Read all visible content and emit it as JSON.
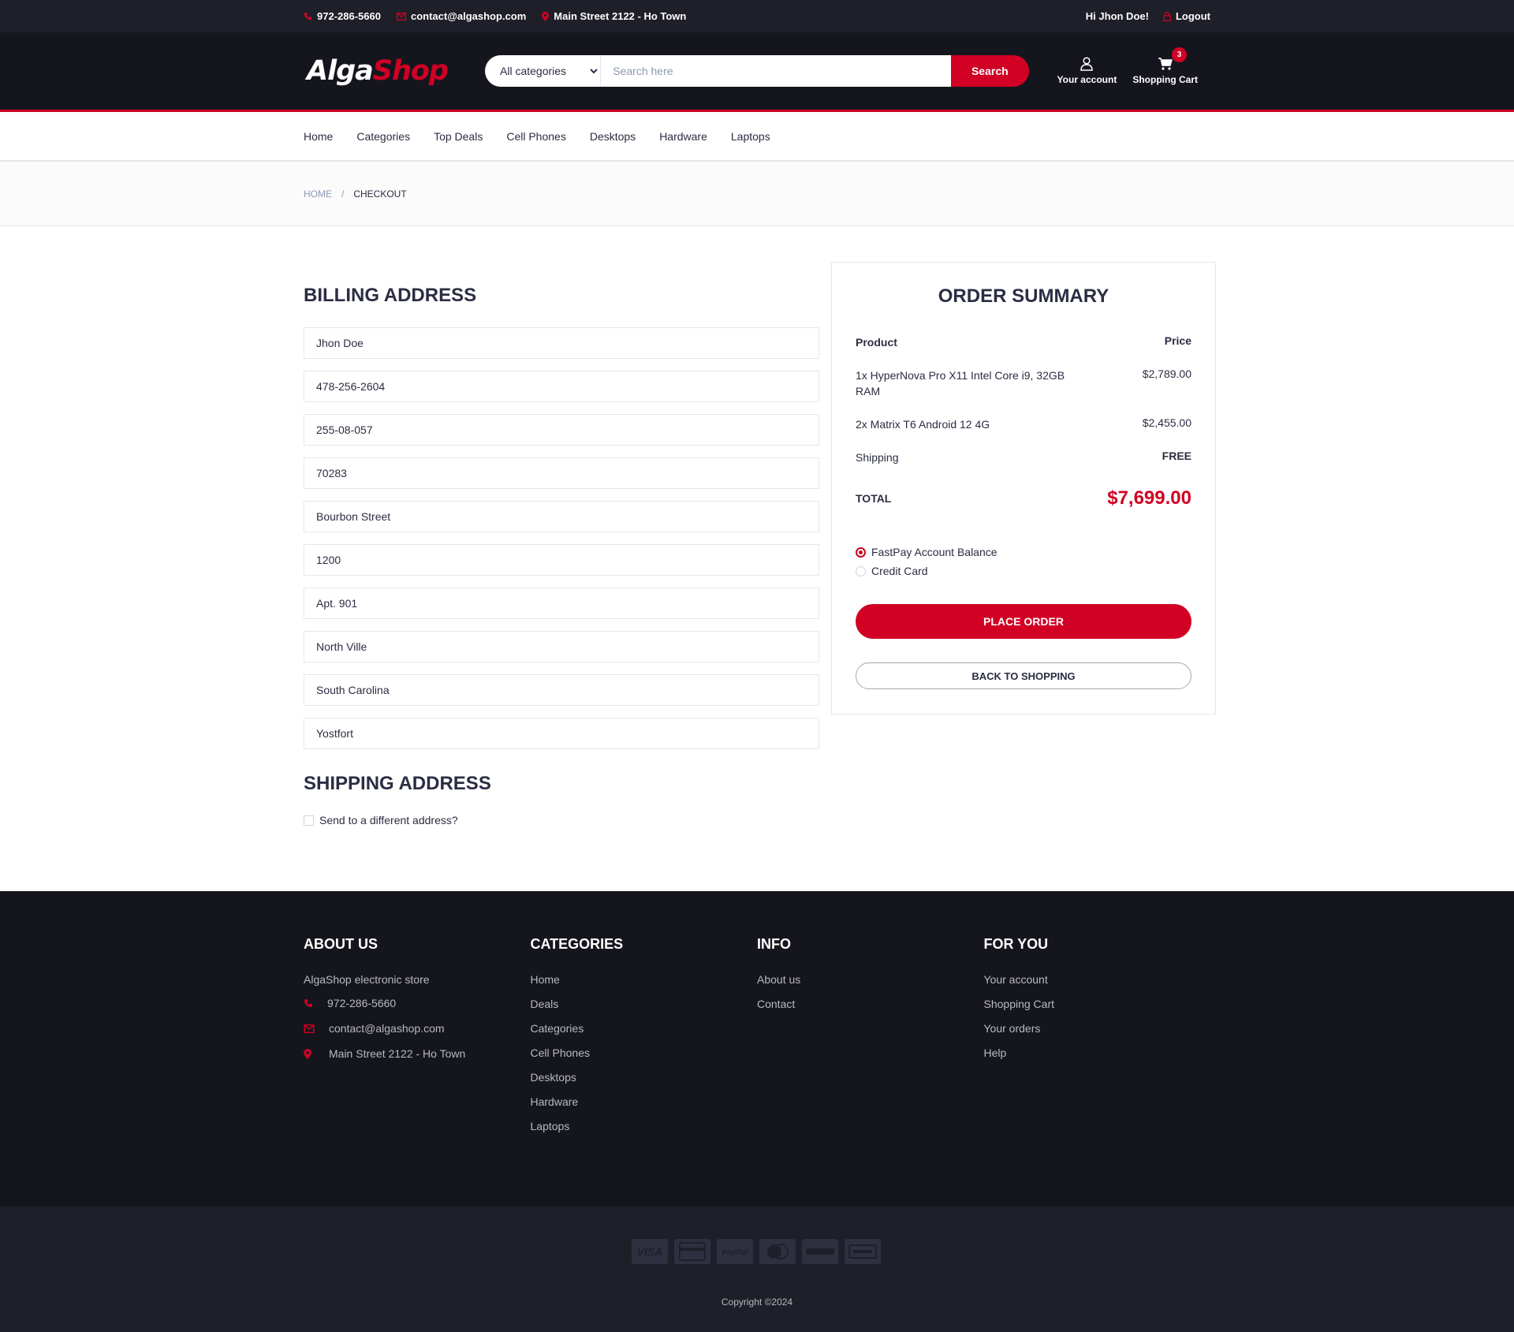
{
  "top_bar": {
    "phone": "972-286-5660",
    "email": "contact@algashop.com",
    "address": "Main Street 2122 - Ho Town",
    "greeting": "Hi Jhon Doe!",
    "logout": "Logout"
  },
  "header": {
    "logo_part1": "Alga",
    "logo_part2": "Shop",
    "category_select": "All categories",
    "search_placeholder": "Search here",
    "search_button": "Search",
    "account_label": "Your account",
    "cart_label": "Shopping Cart",
    "cart_count": "3"
  },
  "nav": {
    "items": [
      "Home",
      "Categories",
      "Top Deals",
      "Cell Phones",
      "Desktops",
      "Hardware",
      "Laptops"
    ]
  },
  "breadcrumb": {
    "home": "Home",
    "separator": "/",
    "current": "Checkout"
  },
  "billing": {
    "title": "Billing address",
    "fields": [
      "Jhon Doe",
      "478-256-2604",
      "255-08-057",
      "70283",
      "Bourbon Street",
      "1200",
      "Apt. 901",
      "North Ville",
      "South Carolina",
      "Yostfort"
    ]
  },
  "shipping": {
    "title": "Shipping address",
    "checkbox_label": "Send to a different address?"
  },
  "summary": {
    "title": "Order summary",
    "col_product": "Product",
    "col_price": "Price",
    "items": [
      {
        "name": "1x HyperNova Pro X11 Intel Core i9, 32GB RAM",
        "price": "$2,789.00"
      },
      {
        "name": "2x Matrix T6 Android 12 4G",
        "price": "$2,455.00"
      }
    ],
    "shipping_label": "Shipping",
    "shipping_value": "FREE",
    "total_label": "Total",
    "total_value": "$7,699.00",
    "payment_options": [
      "FastPay Account Balance",
      "Credit Card"
    ],
    "place_order": "Place order",
    "back_to_shopping": "Back to shopping"
  },
  "footer": {
    "about": {
      "title": "About us",
      "text": "AlgaShop electronic store",
      "phone": "972-286-5660",
      "email": "contact@algashop.com",
      "address": "Main Street 2122 - Ho Town"
    },
    "categories": {
      "title": "Categories",
      "links": [
        "Home",
        "Deals",
        "Categories",
        "Cell Phones",
        "Desktops",
        "Hardware",
        "Laptops"
      ]
    },
    "info": {
      "title": "Info",
      "links": [
        "About us",
        "Contact"
      ]
    },
    "for_you": {
      "title": "For you",
      "links": [
        "Your account",
        "Shopping Cart",
        "Your orders",
        "Help"
      ]
    },
    "payment_icons": [
      "VISA",
      "credit-card",
      "PayPal",
      "mastercard",
      "discover",
      "amex"
    ],
    "copyright": "Copyright ©2024"
  },
  "colors": {
    "accent": "#d10024",
    "header_bg": "#15161d",
    "topbar_bg": "#1e1f29",
    "text": "#2b2d42"
  }
}
